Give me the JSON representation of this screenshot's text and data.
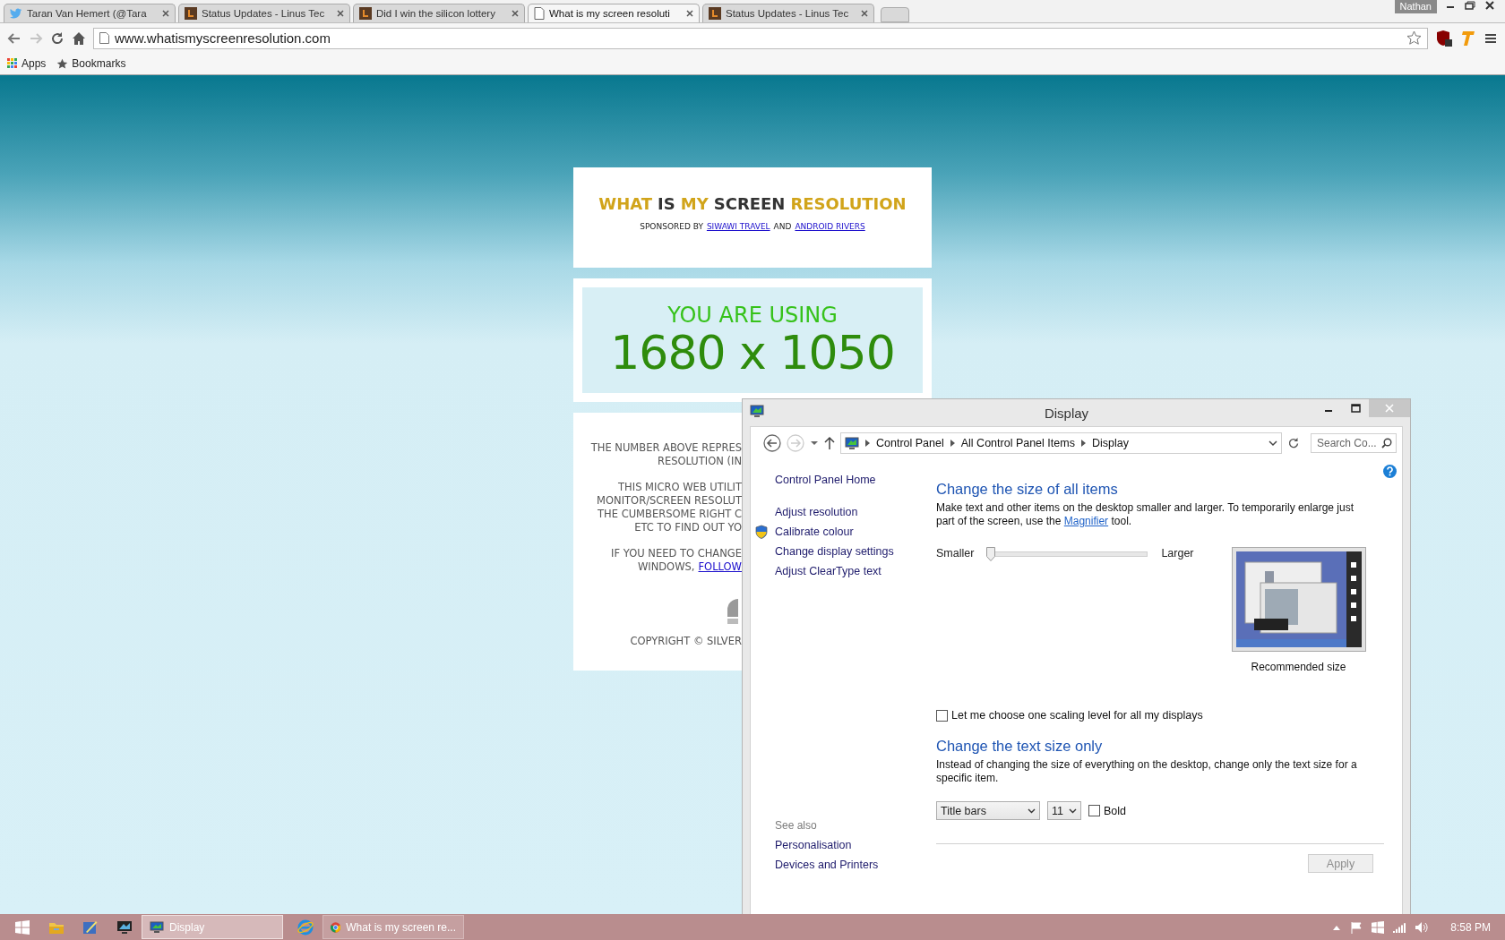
{
  "browser": {
    "tabs": [
      {
        "title": "Taran Van Hemert (@Tara",
        "kind": "bird",
        "selected": false
      },
      {
        "title": "Status Updates - Linus Tec",
        "kind": "forum",
        "selected": false
      },
      {
        "title": "Did I win the silicon lottery",
        "kind": "forum",
        "selected": false
      },
      {
        "title": "What is my screen resoluti",
        "kind": "page",
        "selected": true
      },
      {
        "title": "Status Updates - Linus Tec",
        "kind": "forum",
        "selected": false
      }
    ],
    "user": "Nathan",
    "forward_disabled": true,
    "address": "www.whatismyscreenresolution.com",
    "bookmarks": [
      {
        "label": "Apps",
        "kind": "apps"
      },
      {
        "label": "Bookmarks",
        "kind": "star"
      }
    ]
  },
  "website": {
    "title": [
      {
        "text": "WHAT",
        "highlight": true
      },
      {
        "text": "IS",
        "highlight": false
      },
      {
        "text": "MY",
        "highlight": true
      },
      {
        "text": "SCREEN",
        "highlight": false
      },
      {
        "text": "RESOLUTION",
        "highlight": true
      }
    ],
    "sponsor": [
      {
        "kind": "text",
        "text": "SPONSORED BY"
      },
      {
        "kind": "link",
        "text": "SIWAWI TRAVEL"
      },
      {
        "kind": "text",
        "text": "AND"
      },
      {
        "kind": "link",
        "text": "ANDROID RIVERS"
      }
    ],
    "result_label": "YOU ARE USING",
    "result_value": "1680 x 1050",
    "paragraphs": [
      [
        {
          "text": "THE NUMBER ABOVE REPRES"
        },
        {
          "text": "RESOLUTION (IN"
        }
      ],
      [
        {
          "text": "THIS MICRO WEB UTILIT"
        },
        {
          "text": "MONITOR/SCREEN RESOLUT"
        },
        {
          "text": "THE CUMBERSOME RIGHT C"
        },
        {
          "text": "ETC TO FIND OUT YO"
        }
      ],
      [
        {
          "text": "IF YOU NEED TO CHANGE"
        },
        {
          "text": "WINDOWS,",
          "link": "FOLLOW"
        }
      ]
    ],
    "copyright": "COPYRIGHT © SILVER"
  },
  "display_window": {
    "title": "Display",
    "breadcrumbs": [
      "Control Panel",
      "All Control Panel Items",
      "Display"
    ],
    "search": {
      "placeholder": "Search Co..."
    },
    "sidebar": {
      "links": [
        {
          "label": "Control Panel Home",
          "shield": false
        },
        {
          "label": "Adjust resolution",
          "shield": false
        },
        {
          "label": "Calibrate colour",
          "shield": true
        },
        {
          "label": "Change display settings",
          "shield": false
        },
        {
          "label": "Adjust ClearType text",
          "shield": false
        }
      ],
      "see_also": {
        "heading": "See also",
        "links": [
          "Personalisation",
          "Devices and Printers"
        ]
      }
    },
    "size_section": {
      "heading": "Change the size of all items",
      "text_before": "Make text and other items on the desktop smaller and larger. To temporarily enlarge just part of the screen, use the",
      "link": "Magnifier",
      "text_after": "tool.",
      "slider": {
        "min_label": "Smaller",
        "max_label": "Larger",
        "level": 0
      },
      "preview_caption": "Recommended size",
      "scaling_checkbox": {
        "label": "Let me choose one scaling level for all my displays",
        "checked": false
      }
    },
    "text_section": {
      "heading": "Change the text size only",
      "description": "Instead of changing the size of everything on the desktop, change only the text size for a specific item.",
      "item_select": "Title bars",
      "size_select": "11",
      "bold_checkbox": {
        "label": "Bold",
        "checked": false
      }
    },
    "apply_button": {
      "label": "Apply",
      "disabled": true
    }
  },
  "taskbar": {
    "items": [
      {
        "kind": "start"
      },
      {
        "kind": "explorer"
      },
      {
        "kind": "pen"
      },
      {
        "kind": "monitor-app"
      },
      {
        "kind": "display-task",
        "label": "Display",
        "selected": true
      },
      {
        "kind": "ie"
      },
      {
        "kind": "chrome-task",
        "label": "What is my screen re...",
        "selected": false
      }
    ],
    "time": "8:58 PM"
  }
}
